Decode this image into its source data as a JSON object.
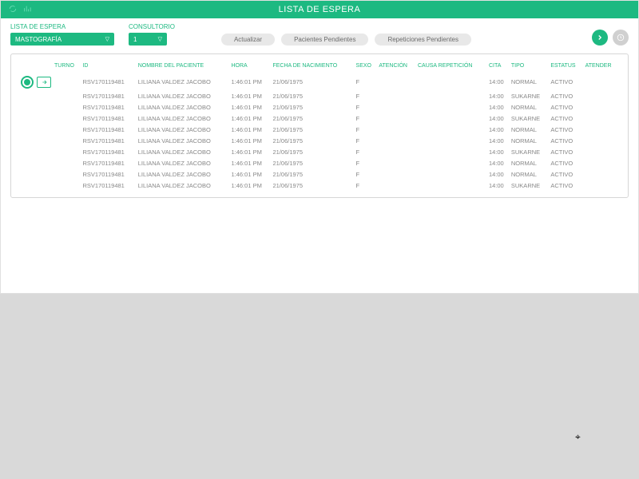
{
  "titlebar": {
    "title": "LISTA DE ESPERA"
  },
  "filters": {
    "waitlist": {
      "label": "LISTA DE ESPERA",
      "value": "MASTOGRAFÍA"
    },
    "office": {
      "label": "CONSULTORIO",
      "value": "1"
    }
  },
  "buttons": {
    "refresh": "Actualizar",
    "pending_patients": "Pacientes Pendientes",
    "pending_repetitions": "Repeticiones Pendientes"
  },
  "table": {
    "headers": {
      "turno": "TURNO",
      "id": "ID",
      "nombre": "NOMBRE DEL PACIENTE",
      "hora": "HORA",
      "fecha": "FECHA DE NACIMIENTO",
      "sexo": "SEXO",
      "atencion": "ATENCIÓN",
      "causa": "CAUSA REPETICIÓN",
      "cita": "CITA",
      "tipo": "TIPO",
      "estatus": "ESTATUS",
      "atender": "ATENDER"
    },
    "rows": [
      {
        "id": "RSV170119481",
        "nombre": "LILIANA VALDEZ JACOBO",
        "hora": "1:46:01 PM",
        "fecha": "21/06/1975",
        "sexo": "F",
        "cita": "14:00",
        "tipo": "NORMAL",
        "estatus": "ACTIVO"
      },
      {
        "id": "RSV170119481",
        "nombre": "LILIANA VALDEZ JACOBO",
        "hora": "1:46:01 PM",
        "fecha": "21/06/1975",
        "sexo": "F",
        "cita": "14:00",
        "tipo": "SUKARNE",
        "estatus": "ACTIVO"
      },
      {
        "id": "RSV170119481",
        "nombre": "LILIANA VALDEZ JACOBO",
        "hora": "1:46:01 PM",
        "fecha": "21/06/1975",
        "sexo": "F",
        "cita": "14:00",
        "tipo": "NORMAL",
        "estatus": "ACTIVO"
      },
      {
        "id": "RSV170119481",
        "nombre": "LILIANA VALDEZ JACOBO",
        "hora": "1:46:01 PM",
        "fecha": "21/06/1975",
        "sexo": "F",
        "cita": "14:00",
        "tipo": "SUKARNE",
        "estatus": "ACTIVO"
      },
      {
        "id": "RSV170119481",
        "nombre": "LILIANA VALDEZ JACOBO",
        "hora": "1:46:01 PM",
        "fecha": "21/06/1975",
        "sexo": "F",
        "cita": "14:00",
        "tipo": "NORMAL",
        "estatus": "ACTIVO"
      },
      {
        "id": "RSV170119481",
        "nombre": "LILIANA VALDEZ JACOBO",
        "hora": "1:46:01 PM",
        "fecha": "21/06/1975",
        "sexo": "F",
        "cita": "14:00",
        "tipo": "NORMAL",
        "estatus": "ACTIVO"
      },
      {
        "id": "RSV170119481",
        "nombre": "LILIANA VALDEZ JACOBO",
        "hora": "1:46:01 PM",
        "fecha": "21/06/1975",
        "sexo": "F",
        "cita": "14:00",
        "tipo": "SUKARNE",
        "estatus": "ACTIVO"
      },
      {
        "id": "RSV170119481",
        "nombre": "LILIANA VALDEZ JACOBO",
        "hora": "1:46:01 PM",
        "fecha": "21/06/1975",
        "sexo": "F",
        "cita": "14:00",
        "tipo": "NORMAL",
        "estatus": "ACTIVO"
      },
      {
        "id": "RSV170119481",
        "nombre": "LILIANA VALDEZ JACOBO",
        "hora": "1:46:01 PM",
        "fecha": "21/06/1975",
        "sexo": "F",
        "cita": "14:00",
        "tipo": "NORMAL",
        "estatus": "ACTIVO"
      },
      {
        "id": "RSV170119481",
        "nombre": "LILIANA VALDEZ JACOBO",
        "hora": "1:46:01 PM",
        "fecha": "21/06/1975",
        "sexo": "F",
        "cita": "14:00",
        "tipo": "SUKARNE",
        "estatus": "ACTIVO"
      }
    ]
  }
}
